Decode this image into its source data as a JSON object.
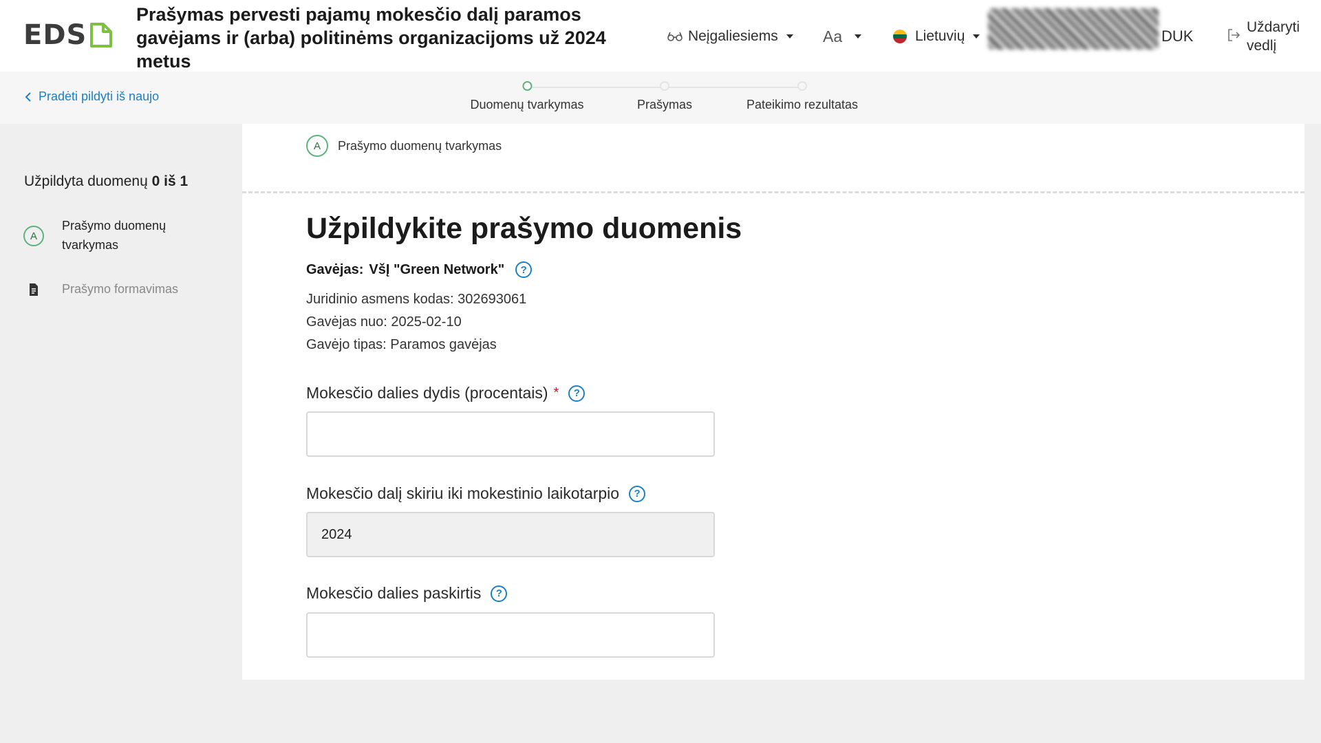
{
  "header": {
    "logo_text": "EDS",
    "title": "Prašymas pervesti pajamų mokesčio dalį paramos gavėjams ir (arba) politinėms organizacijoms už 2024 metus",
    "accessibility_label": "Neįgaliesiems",
    "font_size_label": "Aa",
    "language_label": "Lietuvių",
    "faq_label": "DUK",
    "close_label": "Uždaryti vedlį"
  },
  "stepbar": {
    "back_label": "Pradėti pildyti iš naujo",
    "steps": [
      {
        "label": "Duomenų tvarkymas",
        "active": true
      },
      {
        "label": "Prašymas",
        "active": false
      },
      {
        "label": "Pateikimo rezultatas",
        "active": false
      }
    ]
  },
  "sidebar": {
    "progress_prefix": "Užpildyta duomenų",
    "progress_value": "0 iš 1",
    "items": [
      {
        "badge": "A",
        "label": "Prašymo duomenų tvarkymas"
      },
      {
        "label": "Prašymo formavimas"
      }
    ]
  },
  "main": {
    "section_badge": "A",
    "section_label": "Prašymo duomenų tvarkymas",
    "title": "Užpildykite prašymo duomenis",
    "recipient_label": "Gavėjas:",
    "recipient_name": "VšĮ \"Green Network\"",
    "legal_code": "Juridinio asmens kodas: 302693061",
    "recipient_since": "Gavėjas nuo: 2025-02-10",
    "recipient_type": "Gavėjo tipas: Paramos gavėjas",
    "fields": [
      {
        "label": "Mokesčio dalies dydis (procentais)",
        "required": true,
        "value": ""
      },
      {
        "label": "Mokesčio dalį skiriu iki mokestinio laikotarpio",
        "required": false,
        "value": "2024"
      },
      {
        "label": "Mokesčio dalies paskirtis",
        "required": false,
        "value": ""
      }
    ],
    "required_mark": "*",
    "help_glyph": "?"
  },
  "colors": {
    "link": "#1b80c4",
    "accent_green": "#5db37e",
    "required": "#d0142a"
  },
  "icons": {
    "logo_doc": "document-icon",
    "accessibility": "glasses-icon",
    "language": "flag-lt-icon",
    "close": "exit-icon",
    "back": "chevron-left-icon",
    "help": "question-circle-icon"
  }
}
